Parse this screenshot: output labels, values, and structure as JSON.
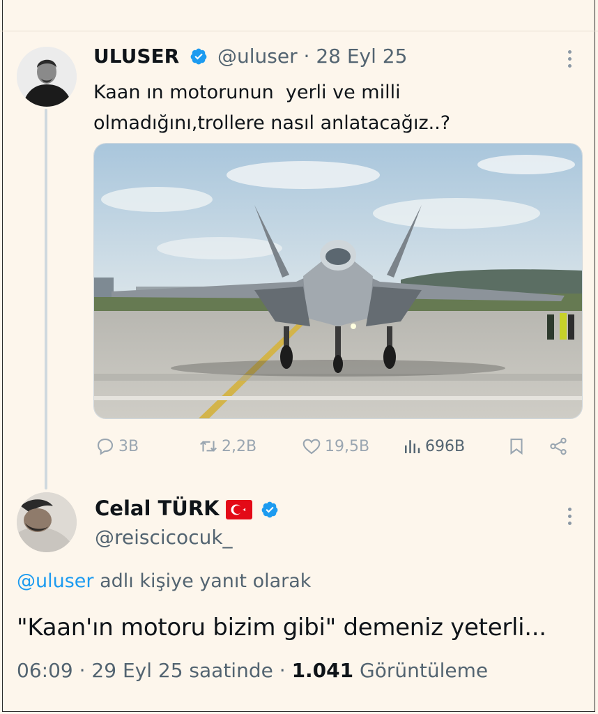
{
  "tweet1": {
    "display_name": "ULUSER",
    "handle": "@uluser",
    "separator": "·",
    "date": "28 Eyl 25",
    "text_line1": "Kaan ın motorunun  yerli ve milli",
    "text_line2": "olmadığını,trollere nasıl anlatacağız..?",
    "actions": {
      "replies": "3B",
      "reposts": "2,2B",
      "likes": "19,5B",
      "views": "696B"
    }
  },
  "tweet2": {
    "display_name": "Celal TÜRK",
    "handle": "@reiscicocuk_",
    "reply_to_handle": "@uluser",
    "reply_suffix": "adlı kişiye yanıt olarak",
    "text": "\"Kaan'ın motoru bizim gibi\" demeniz yeterli...",
    "time": "06:09",
    "dot": "·",
    "date": "29 Eyl 25 saatinde",
    "views_count": "1.041",
    "views_label": "Görüntüleme"
  },
  "colors": {
    "background": "#fdf6ec",
    "verified_blue": "#1d9bf0",
    "link_blue": "#1d9bf0",
    "muted": "#536471",
    "flag_red": "#e30a17"
  },
  "icons": [
    "verified-icon",
    "more-icon",
    "reply-icon",
    "repost-icon",
    "like-icon",
    "views-icon",
    "bookmark-icon",
    "share-icon",
    "turkish-flag-icon"
  ]
}
